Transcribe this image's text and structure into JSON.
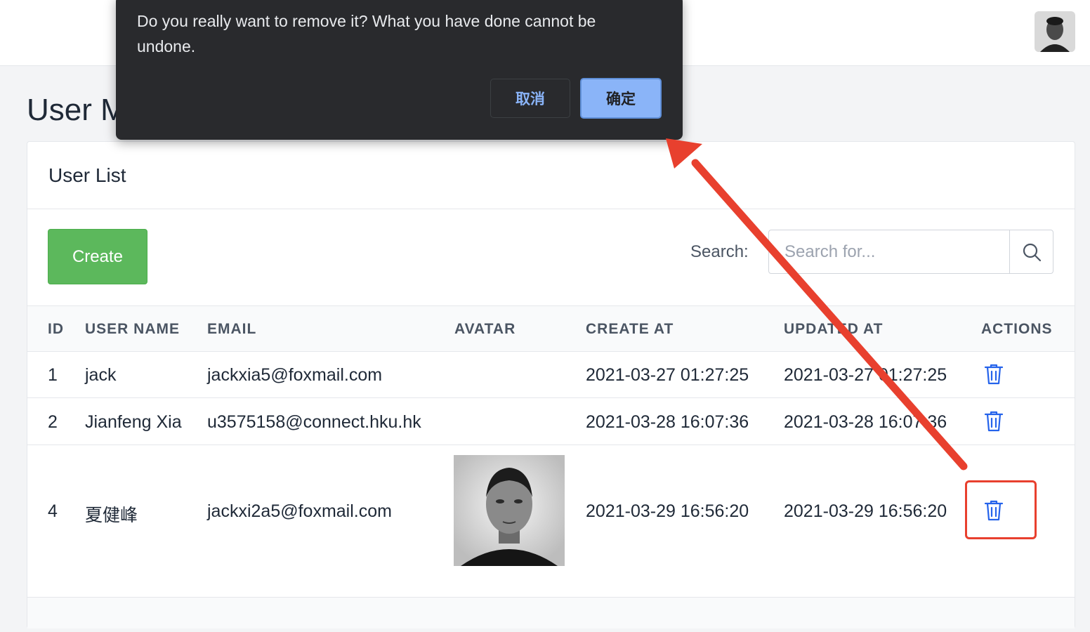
{
  "header": {
    "avatar_icon": "user-avatar-photo"
  },
  "page": {
    "title": "User M"
  },
  "card": {
    "title": "User List",
    "create_label": "Create",
    "search_label": "Search:",
    "search_placeholder": "Search for...",
    "search_icon": "search-icon"
  },
  "table": {
    "columns": [
      "ID",
      "USER NAME",
      "EMAIL",
      "AVATAR",
      "CREATE AT",
      "UPDATED AT",
      "ACTIONS"
    ],
    "rows": [
      {
        "id": "1",
        "name": "jack",
        "email": "jackxia5@foxmail.com",
        "avatar": "",
        "create_at": "2021-03-27 01:27:25",
        "updated_at": "2021-03-27 01:27:25",
        "action_icon": "trash-icon"
      },
      {
        "id": "2",
        "name": "Jianfeng Xia",
        "email": "u3575158@connect.hku.hk",
        "avatar": "",
        "create_at": "2021-03-28 16:07:36",
        "updated_at": "2021-03-28 16:07:36",
        "action_icon": "trash-icon"
      },
      {
        "id": "4",
        "name": "夏健峰",
        "email": "jackxi2a5@foxmail.com",
        "avatar": "user-photo",
        "create_at": "2021-03-29 16:56:20",
        "updated_at": "2021-03-29 16:56:20",
        "action_icon": "trash-icon"
      }
    ]
  },
  "dialog": {
    "message": "Do you really want to remove it? What you have done cannot be undone.",
    "cancel_label": "取消",
    "ok_label": "确定"
  },
  "colors": {
    "create_button": "#5cb85c",
    "trash_icon": "#2563eb",
    "dialog_bg": "#292a2d",
    "dialog_ok": "#8ab4f8",
    "annotation": "#e8402e"
  }
}
